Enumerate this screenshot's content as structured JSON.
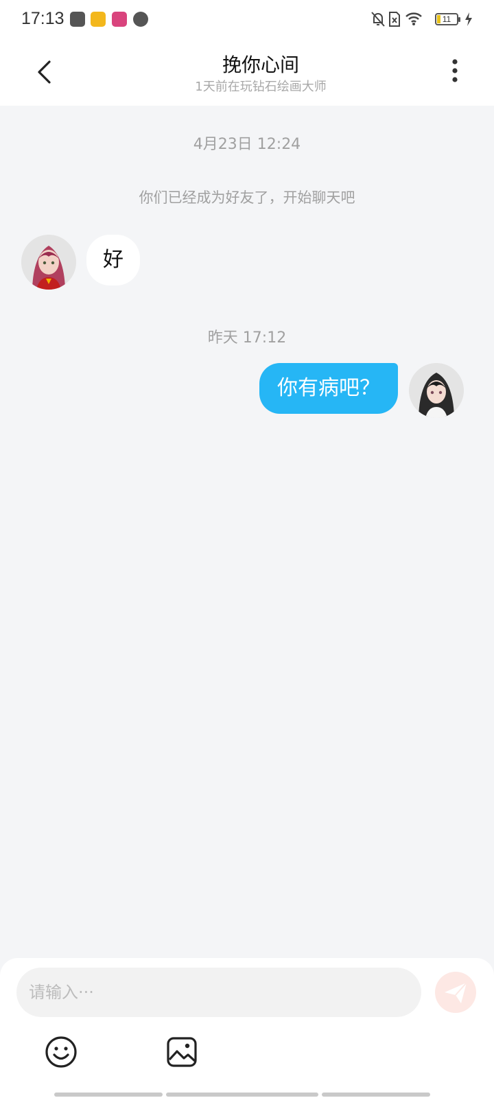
{
  "status_bar": {
    "time": "17:13",
    "battery_level": "11",
    "icons": [
      "scissors-app-icon",
      "weibo-app-icon",
      "anime-app-icon",
      "compass-app-icon",
      "mute-bell-icon",
      "no-sim-icon",
      "wifi-icon",
      "battery-icon",
      "charging-icon"
    ]
  },
  "header": {
    "title": "挽你心间",
    "subtitle": "1天前在玩钻石绘画大师",
    "back_icon": "chevron-left-icon",
    "more_icon": "more-vertical-icon"
  },
  "chat": {
    "timestamp_1": "4月23日 12:24",
    "system_message": "你们已经成为好友了，开始聊天吧",
    "message_in_text": "好",
    "timestamp_2": "昨天 17:12",
    "message_out_text": "你有病吧？"
  },
  "input": {
    "placeholder": "请输入···",
    "value": "",
    "send_icon": "paper-plane-icon",
    "emoji_icon": "smiley-icon",
    "image_icon": "image-icon"
  },
  "colors": {
    "accent_bubble": "#26b6f5",
    "background": "#f4f5f7",
    "send_disabled": "#fde8e4"
  }
}
